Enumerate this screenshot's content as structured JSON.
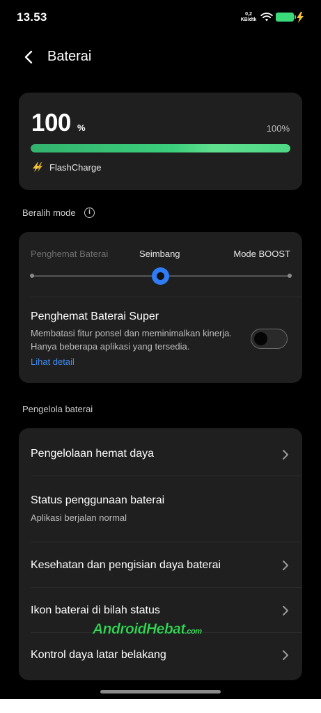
{
  "status_bar": {
    "time": "13.53",
    "net_speed_value": "0,2",
    "net_speed_unit": "KB/dtk",
    "battery_color": "#3ad97a"
  },
  "header": {
    "title": "Baterai",
    "back_icon": "chevron-left-icon"
  },
  "battery": {
    "level": "100",
    "unit": "%",
    "percent_label": "100%",
    "fill_fraction": 1.0,
    "charge_mode": "FlashCharge",
    "charge_icon": "flash-charge-icon"
  },
  "mode_section": {
    "label": "Beralih mode",
    "info_icon": "info-icon",
    "options": [
      "Penghemat Baterai",
      "Seimbang",
      "Mode BOOST"
    ],
    "selected": "Seimbang",
    "super_saver": {
      "title": "Penghemat Baterai Super",
      "description": "Membatasi fitur ponsel dan meminimalkan kinerja. Hanya beberapa aplikasi yang tersedia.",
      "link": "Lihat detail",
      "enabled": false
    }
  },
  "manager_section": {
    "label": "Pengelola baterai",
    "items": [
      {
        "title": "Pengelolaan hemat daya",
        "subtitle": ""
      },
      {
        "title": "Status penggunaan baterai",
        "subtitle": "Aplikasi berjalan normal"
      },
      {
        "title": "Kesehatan dan pengisian daya baterai",
        "subtitle": ""
      },
      {
        "title": "Ikon baterai di bilah status",
        "subtitle": ""
      },
      {
        "title": "Kontrol daya latar belakang",
        "subtitle": ""
      }
    ]
  },
  "watermark": {
    "brand": "AndroidHebat",
    "domain": ".com"
  },
  "colors": {
    "accent_blue": "#2e7cf6",
    "link_blue": "#3d8bf2",
    "card_bg": "#1f1f1f",
    "battery_green": "#3bcf7c"
  }
}
